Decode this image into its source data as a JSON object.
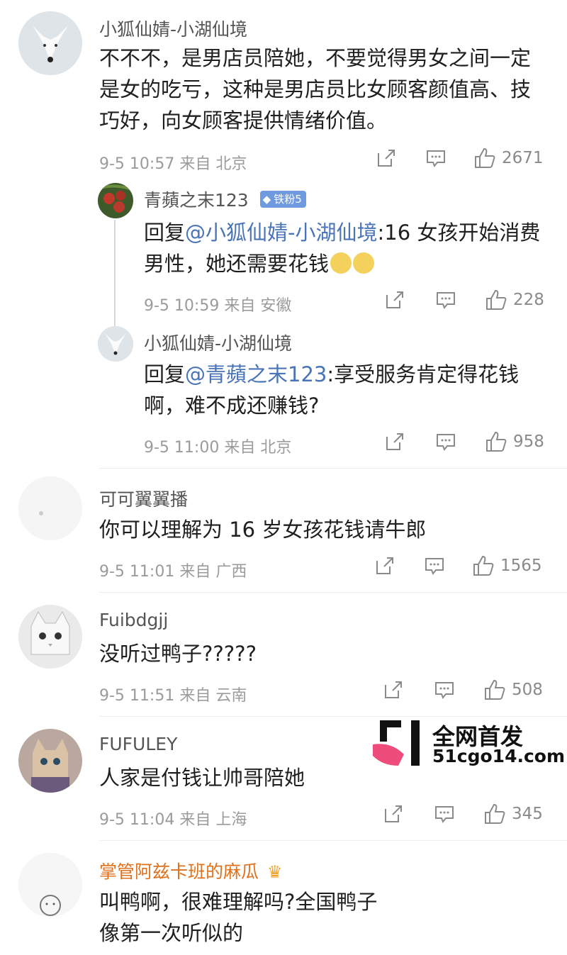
{
  "colors": {
    "mention": "#4a74b8",
    "vip_name": "#e0711c",
    "meta": "#9b9b9b",
    "badge": "#6f9ae0"
  },
  "comments": [
    {
      "user": "小狐仙婧-小湖仙境",
      "text": "不不不，是男店员陪她，不要觉得男女之间一定是女的吃亏，这种是男店员比女顾客颜值高、技巧好，向女顾客提供情绪价值。",
      "meta": "9-5 10:57 来自 北京",
      "likes": "2671",
      "avatar_icon": "white-fox-avatar",
      "replies": [
        {
          "user": "青蘋之末123",
          "badge": "铁粉5",
          "reply_prefix": "回复",
          "mention": "@小狐仙婧-小湖仙境",
          "text": ":16 女孩开始消费男性，她还需要花钱",
          "meta": "9-5 10:59 来自 安徽",
          "likes": "228",
          "avatar_icon": "fruit-tree-avatar"
        },
        {
          "user": "小狐仙婧-小湖仙境",
          "reply_prefix": "回复",
          "mention": "@青蘋之末123",
          "text": ":享受服务肯定得花钱啊，难不成还赚钱?",
          "meta": "9-5 11:00 来自 北京",
          "likes": "958",
          "avatar_icon": "white-fox-avatar"
        }
      ]
    },
    {
      "user": "可可翼翼播",
      "text": "你可以理解为 16 岁女孩花钱请牛郎",
      "meta": "9-5 11:01 来自 广西",
      "likes": "1565",
      "avatar_icon": "blank-avatar"
    },
    {
      "user": "Fuibdgjj",
      "text": "没听过鸭子?????",
      "meta": "9-5 11:51 来自 云南",
      "likes": "508",
      "avatar_icon": "cat-avatar"
    },
    {
      "user": "FUFULEY",
      "text": "人家是付钱让帅哥陪她",
      "meta": "9-5 11:04 来自 上海",
      "likes": "345",
      "avatar_icon": "cartoon-cat-avatar"
    },
    {
      "user": "掌管阿兹卡班的麻瓜",
      "text": "叫鸭啊，很难理解吗?全国鸭子",
      "text_line2": "像第一次听似的",
      "avatar_icon": "sketch-avatar"
    }
  ],
  "watermark": {
    "line1": "全网首发",
    "line2": "51cgo14.com"
  }
}
